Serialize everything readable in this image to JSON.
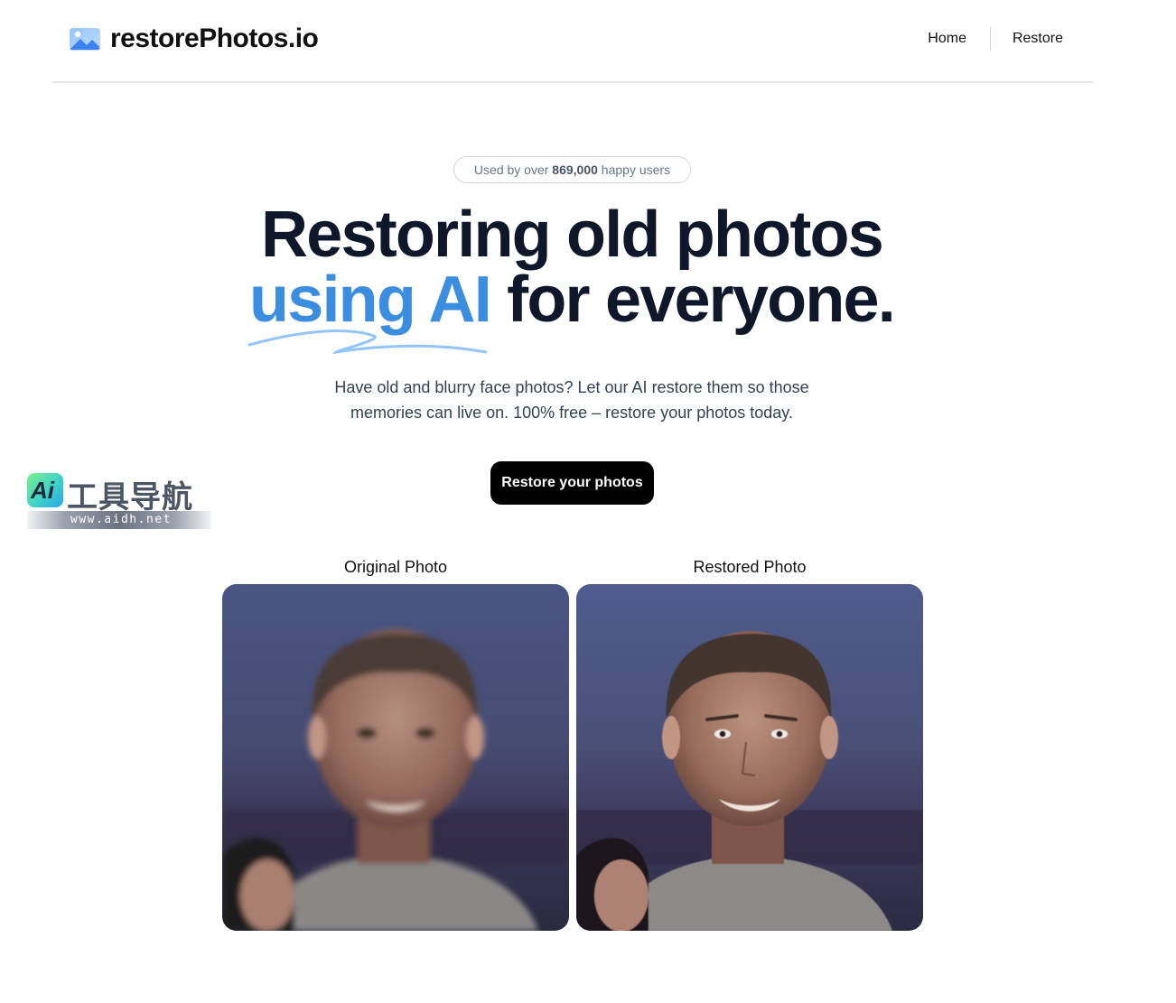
{
  "header": {
    "brand": "restorePhotos.io",
    "brand_icon": "photo-icon",
    "nav": [
      {
        "label": "Home"
      },
      {
        "label": "Restore"
      }
    ]
  },
  "hero": {
    "pill_prefix": "Used by over",
    "pill_count": "869,000",
    "pill_suffix": "happy users",
    "headline_line1": "Restoring old photos",
    "headline_accent": "using AI",
    "headline_rest": "for everyone.",
    "subtitle": "Have old and blurry face photos? Let our AI restore them so those memories can live on. 100% free – restore your photos today.",
    "cta_label": "Restore your photos",
    "accent_color": "#3b8de0"
  },
  "watermark": {
    "logo_text": "Ai",
    "title": "工具导航",
    "url": "www.aidh.net"
  },
  "comparison": {
    "original_label": "Original Photo",
    "restored_label": "Restored Photo"
  }
}
